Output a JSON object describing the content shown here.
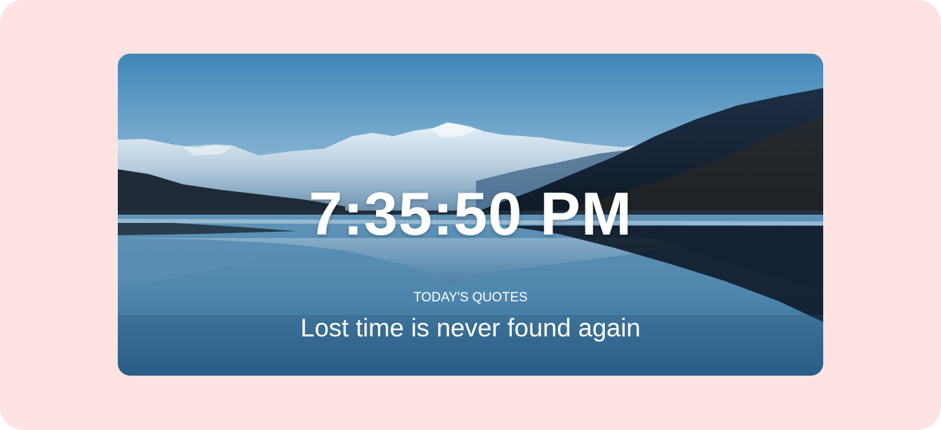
{
  "clock": {
    "time": "7:35:50 PM"
  },
  "quotes": {
    "heading": "TODAY'S QUOTES",
    "text": "Lost time is never found again"
  },
  "colors": {
    "page_background": "#ffe2e2",
    "sky_top": "#3f86b8",
    "sky_bottom": "#a9cbe0",
    "text": "#ffffff"
  },
  "background_image": "mountain-lake-landscape"
}
